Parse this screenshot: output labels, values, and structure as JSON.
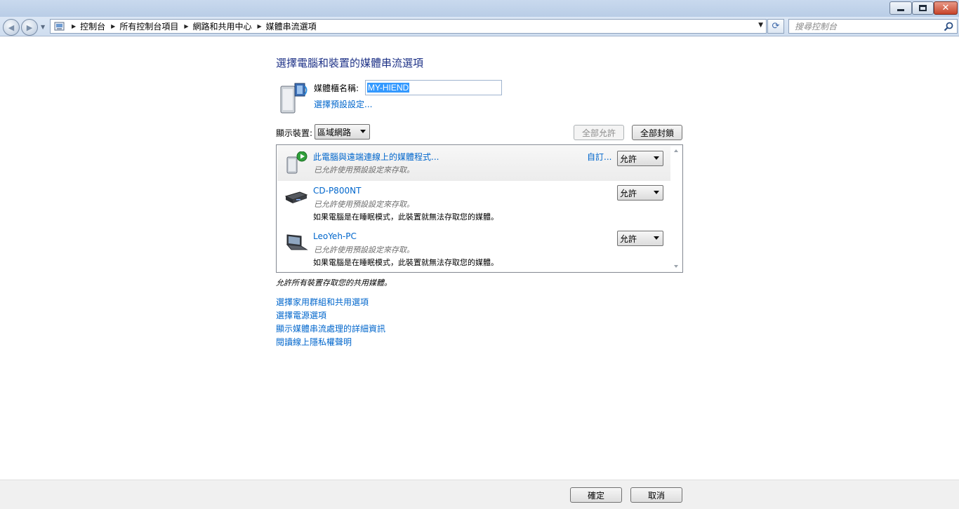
{
  "window": {
    "minimize_label": "",
    "close_glyph": "✕"
  },
  "navigation": {
    "breadcrumbs": [
      {
        "label": "控制台"
      },
      {
        "label": "所有控制台項目"
      },
      {
        "label": "網路和共用中心"
      },
      {
        "label": "媒體串流選項"
      }
    ],
    "search_placeholder": "搜尋控制台"
  },
  "main": {
    "title": "選擇電腦和裝置的媒體串流選項",
    "library_name_label": "媒體櫃名稱:",
    "library_name_value": "MY-HIEND",
    "choose_defaults_link": "選擇預設設定...",
    "show_devices_label": "顯示裝置:",
    "show_devices_value": "區域網路",
    "allow_all_label": "全部允許",
    "block_all_label": "全部封鎖",
    "devices": [
      {
        "name": "此電腦與遠端連線上的媒體程式...",
        "sub": "已允許使用預設設定來存取。",
        "note": "",
        "custom_link": "自訂...",
        "permission": "允許",
        "icon": "media-program-icon"
      },
      {
        "name": "CD-P800NT",
        "sub": "已允許使用預設設定來存取。",
        "note": "如果電腦是在睡眠模式，此裝置就無法存取您的媒體。",
        "permission": "允許",
        "icon": "media-player-device-icon"
      },
      {
        "name": "LeoYeh-PC",
        "sub": "已允許使用預設設定來存取。",
        "note": "如果電腦是在睡眠模式，此裝置就無法存取您的媒體。",
        "permission": "允許",
        "icon": "laptop-icon"
      }
    ],
    "allow_all_note": "允許所有裝置存取您的共用媒體。",
    "links": [
      "選擇家用群組和共用選項",
      "選擇電源選項",
      "顯示媒體串流處理的詳細資訊",
      "閱讀線上隱私權聲明"
    ]
  },
  "footer": {
    "ok_label": "確定",
    "cancel_label": "取消"
  }
}
